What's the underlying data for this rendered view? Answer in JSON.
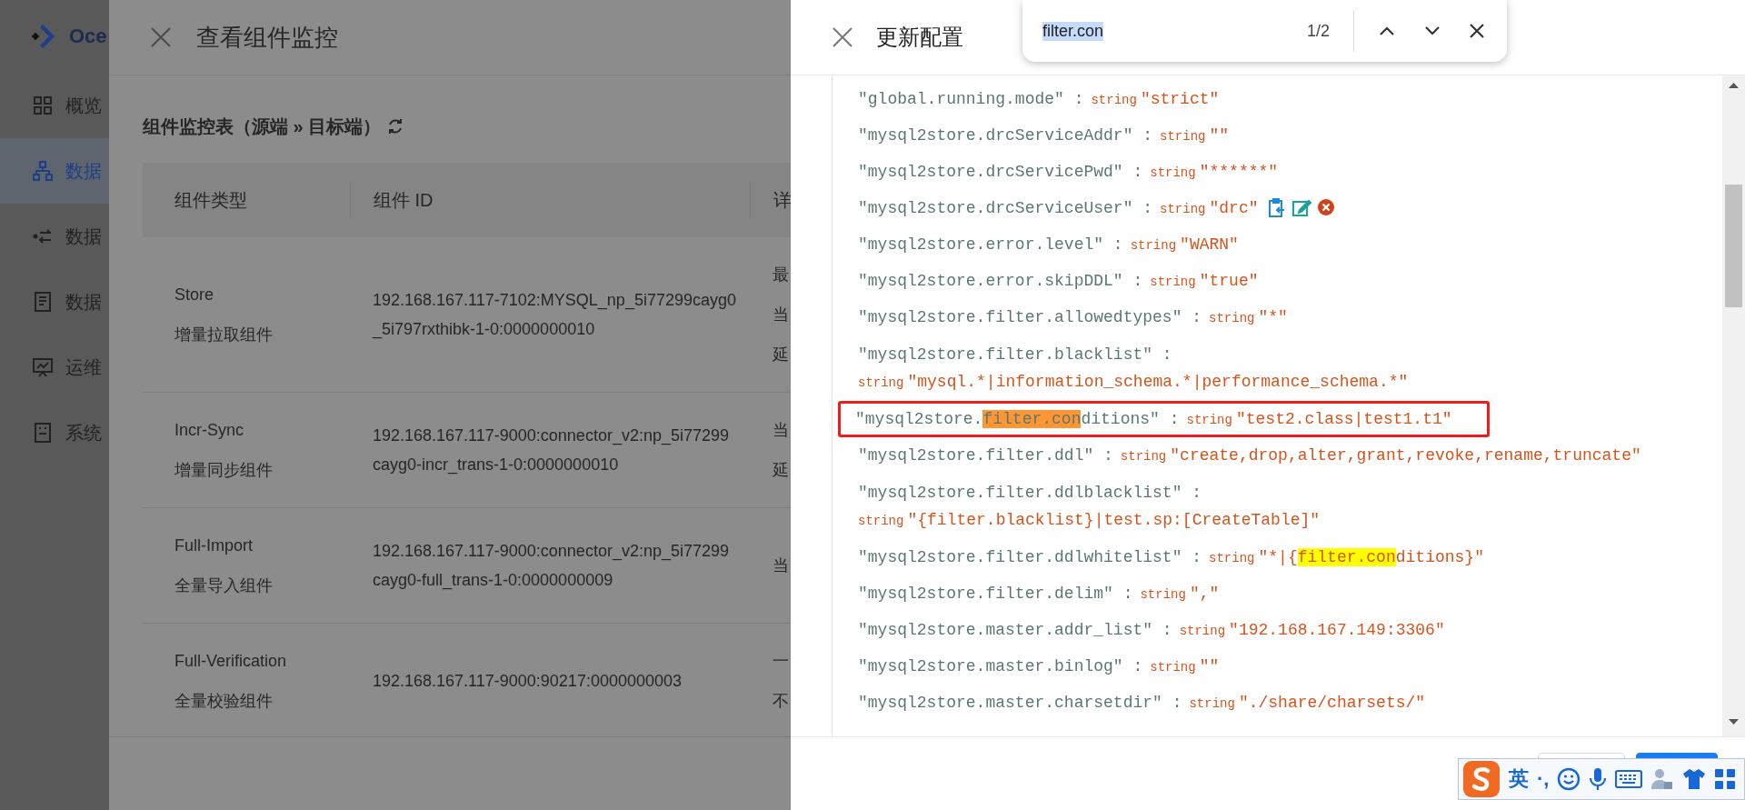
{
  "sidebar": {
    "logo_text": "Oce",
    "items": [
      {
        "label": "概览",
        "selected": false
      },
      {
        "label": "数据",
        "selected": true
      },
      {
        "label": "数据",
        "selected": false
      },
      {
        "label": "数据",
        "selected": false
      },
      {
        "label": "运维",
        "selected": false
      },
      {
        "label": "系统",
        "selected": false
      }
    ]
  },
  "monitor_drawer": {
    "title": "查看组件监控",
    "table_title": "组件监控表（源端 » 目标端）",
    "table": {
      "columns": [
        "组件类型",
        "组件 ID",
        "详"
      ],
      "rows": [
        {
          "type": "Store",
          "type_cn": "增量拉取组件",
          "id": "192.168.167.117-7102:MYSQL_np_5i77299cayg0_5i797rxthibk-1-0:0000000010",
          "detail": [
            "最",
            "当",
            "延"
          ]
        },
        {
          "type": "Incr-Sync",
          "type_cn": "增量同步组件",
          "id": "192.168.167.117-9000:connector_v2:np_5i77299cayg0-incr_trans-1-0:0000000010",
          "detail": [
            "当",
            "延"
          ]
        },
        {
          "type": "Full-Import",
          "type_cn": "全量导入组件",
          "id": "192.168.167.117-9000:connector_v2:np_5i77299cayg0-full_trans-1-0:0000000009",
          "detail": [
            "当"
          ]
        },
        {
          "type": "Full-Verification",
          "type_cn": "全量校验组件",
          "id": "192.168.167.117-9000:90217:0000000003",
          "detail": [
            "一",
            "不"
          ]
        }
      ]
    }
  },
  "config_drawer": {
    "title": "更新配置",
    "lines": [
      {
        "key": [
          {
            "text": "\"global.running.mode\" :",
            "highlighted": false
          }
        ],
        "type_label": "string",
        "value": [
          {
            "text": "\"strict\"",
            "highlighted": false
          }
        ],
        "wrap": false,
        "outlined": false,
        "actions": false
      },
      {
        "key": [
          {
            "text": "\"mysql2store.drcServiceAddr\" :",
            "highlighted": false
          }
        ],
        "type_label": "string",
        "value": [
          {
            "text": "\"\"",
            "highlighted": false
          }
        ],
        "wrap": false,
        "outlined": false,
        "actions": false
      },
      {
        "key": [
          {
            "text": "\"mysql2store.drcServicePwd\" :",
            "highlighted": false
          }
        ],
        "type_label": "string",
        "value": [
          {
            "text": "\"******\"",
            "highlighted": false
          }
        ],
        "wrap": false,
        "outlined": false,
        "actions": false
      },
      {
        "key": [
          {
            "text": "\"mysql2store.drcServiceUser\" :",
            "highlighted": false
          }
        ],
        "type_label": "string",
        "value": [
          {
            "text": "\"drc\"",
            "highlighted": false
          }
        ],
        "wrap": false,
        "outlined": false,
        "actions": true
      },
      {
        "key": [
          {
            "text": "\"mysql2store.error.level\" :",
            "highlighted": false
          }
        ],
        "type_label": "string",
        "value": [
          {
            "text": "\"WARN\"",
            "highlighted": false
          }
        ],
        "wrap": false,
        "outlined": false,
        "actions": false
      },
      {
        "key": [
          {
            "text": "\"mysql2store.error.skipDDL\" :",
            "highlighted": false
          }
        ],
        "type_label": "string",
        "value": [
          {
            "text": "\"true\"",
            "highlighted": false
          }
        ],
        "wrap": false,
        "outlined": false,
        "actions": false
      },
      {
        "key": [
          {
            "text": "\"mysql2store.filter.allowedtypes\" :",
            "highlighted": false
          }
        ],
        "type_label": "string",
        "value": [
          {
            "text": "\"*\"",
            "highlighted": false
          }
        ],
        "wrap": false,
        "outlined": false,
        "actions": false
      },
      {
        "key": [
          {
            "text": "\"mysql2store.filter.blacklist\" :",
            "highlighted": false
          }
        ],
        "type_label": "string",
        "value": [
          {
            "text": "\"mysql.*|information_schema.*|performance_schema.*\"",
            "highlighted": false
          }
        ],
        "wrap": true,
        "outlined": false,
        "actions": false
      },
      {
        "key": [
          {
            "text": "\"mysql2store.",
            "highlighted": false
          },
          {
            "text": "filter.con",
            "highlighted": true,
            "color": "#ff9632"
          },
          {
            "text": "ditions\" :",
            "highlighted": false
          }
        ],
        "type_label": "string",
        "value": [
          {
            "text": "\"test2.class|test1.t1\"",
            "highlighted": false
          }
        ],
        "wrap": false,
        "outlined": true,
        "actions": false
      },
      {
        "key": [
          {
            "text": "\"mysql2store.filter.ddl\" :",
            "highlighted": false
          }
        ],
        "type_label": "string",
        "value": [
          {
            "text": "\"create,drop,alter,grant,revoke,rename,truncate\"",
            "highlighted": false
          }
        ],
        "wrap": false,
        "outlined": false,
        "actions": false
      },
      {
        "key": [
          {
            "text": "\"mysql2store.filter.ddlblacklist\" :",
            "highlighted": false
          }
        ],
        "type_label": "string",
        "value": [
          {
            "text": "\"{filter.blacklist}|test.sp:[CreateTable]\"",
            "highlighted": false
          }
        ],
        "wrap": true,
        "outlined": false,
        "actions": false
      },
      {
        "key": [
          {
            "text": "\"mysql2store.filter.ddlwhitelist\" :",
            "highlighted": false
          }
        ],
        "type_label": "string",
        "value": [
          {
            "text": "\"*|{",
            "highlighted": false
          },
          {
            "text": "filter.con",
            "highlighted": true,
            "color": "#ffff00"
          },
          {
            "text": "ditions}\"",
            "highlighted": false
          }
        ],
        "wrap": false,
        "outlined": false,
        "actions": false
      },
      {
        "key": [
          {
            "text": "\"mysql2store.filter.delim\" :",
            "highlighted": false
          }
        ],
        "type_label": "string",
        "value": [
          {
            "text": "\",\"",
            "highlighted": false
          }
        ],
        "wrap": false,
        "outlined": false,
        "actions": false
      },
      {
        "key": [
          {
            "text": "\"mysql2store.master.addr_list\" :",
            "highlighted": false
          }
        ],
        "type_label": "string",
        "value": [
          {
            "text": "\"192.168.167.149:3306\"",
            "highlighted": false
          }
        ],
        "wrap": false,
        "outlined": false,
        "actions": false
      },
      {
        "key": [
          {
            "text": "\"mysql2store.master.binlog\" :",
            "highlighted": false
          }
        ],
        "type_label": "string",
        "value": [
          {
            "text": "\"\"",
            "highlighted": false
          }
        ],
        "wrap": false,
        "outlined": false,
        "actions": false
      },
      {
        "key": [
          {
            "text": "\"mysql2store.master.charsetdir\" :",
            "highlighted": false
          }
        ],
        "type_label": "string",
        "value": [
          {
            "text": "\"./share/charsets/\"",
            "highlighted": false
          }
        ],
        "wrap": false,
        "outlined": false,
        "actions": false
      }
    ],
    "footer_buttons": [
      {
        "kind": "default"
      },
      {
        "kind": "primary"
      }
    ]
  },
  "find_bar": {
    "query": "filter.con",
    "count": "1/2"
  },
  "ime_bar": {
    "mode": "英",
    "punctuation": "·,"
  }
}
